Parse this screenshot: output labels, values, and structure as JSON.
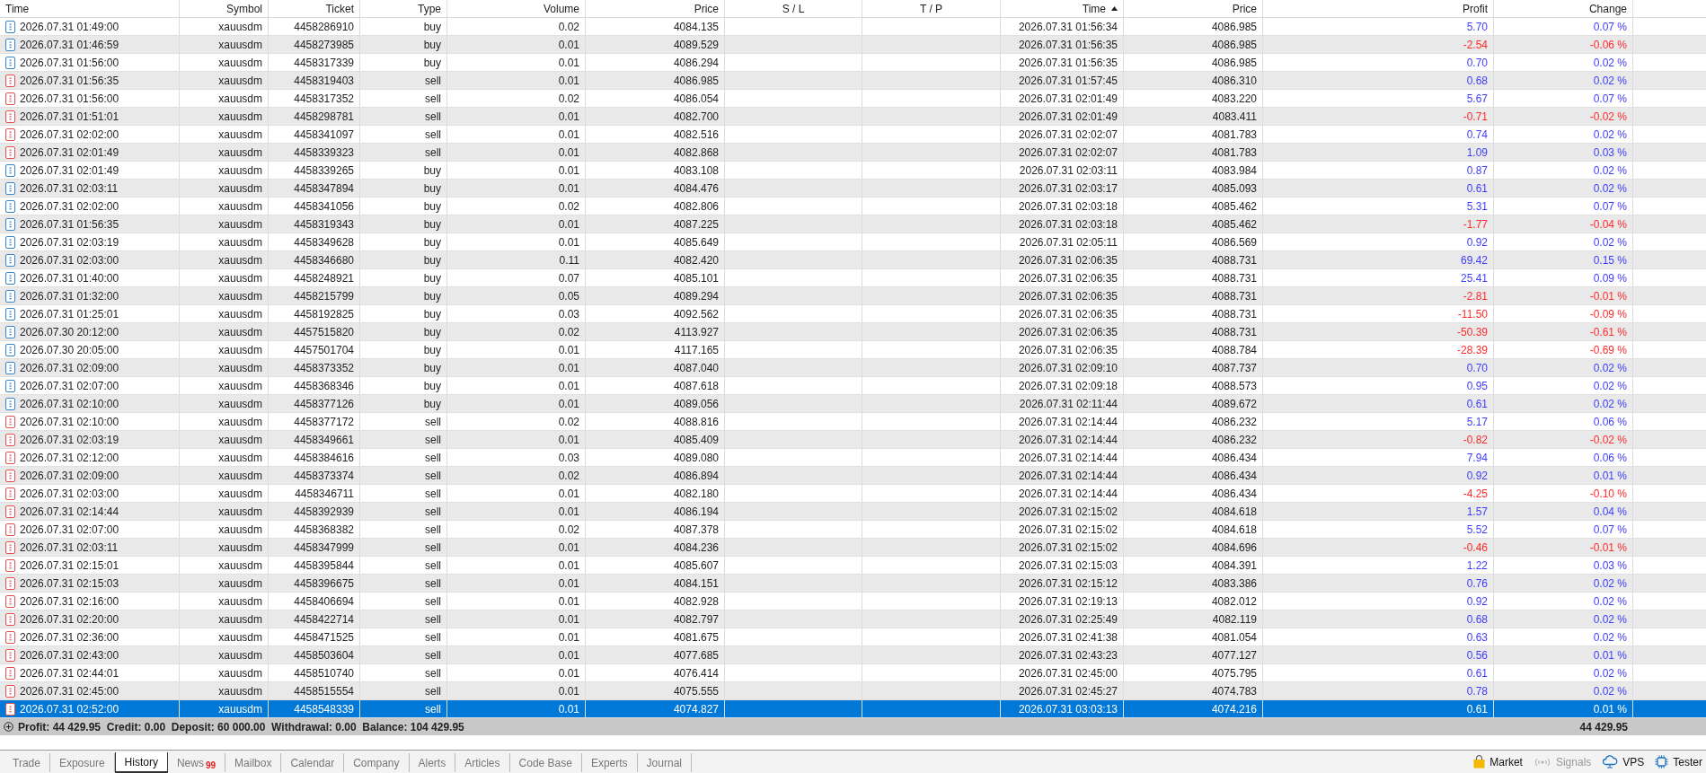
{
  "table": {
    "columns": [
      {
        "label": "Time",
        "sorted": false
      },
      {
        "label": "Symbol",
        "sorted": false
      },
      {
        "label": "Ticket",
        "sorted": false
      },
      {
        "label": "Type",
        "sorted": false
      },
      {
        "label": "Volume",
        "sorted": false
      },
      {
        "label": "Price",
        "sorted": false
      },
      {
        "label": "S / L",
        "sorted": false
      },
      {
        "label": "T / P",
        "sorted": false
      },
      {
        "label": "Time",
        "sorted": true
      },
      {
        "label": "Price",
        "sorted": false
      },
      {
        "label": "Profit",
        "sorted": false
      },
      {
        "label": "Change",
        "sorted": false
      }
    ],
    "rows": [
      {
        "open_time": "2026.07.31 01:49:00",
        "symbol": "xauusdm",
        "ticket": "4458286910",
        "type": "buy",
        "kind": "buy",
        "volume": "0.02",
        "open_price": "4084.135",
        "close_time": "2026.07.31 01:56:34",
        "close_price": "4086.985",
        "profit": "5.70",
        "change": "0.07 %",
        "loss": false,
        "selected": false
      },
      {
        "open_time": "2026.07.31 01:46:59",
        "symbol": "xauusdm",
        "ticket": "4458273985",
        "type": "buy",
        "kind": "buy",
        "volume": "0.01",
        "open_price": "4089.529",
        "close_time": "2026.07.31 01:56:35",
        "close_price": "4086.985",
        "profit": "-2.54",
        "change": "-0.06 %",
        "loss": true,
        "selected": false
      },
      {
        "open_time": "2026.07.31 01:56:00",
        "symbol": "xauusdm",
        "ticket": "4458317339",
        "type": "buy",
        "kind": "buy",
        "volume": "0.01",
        "open_price": "4086.294",
        "close_time": "2026.07.31 01:56:35",
        "close_price": "4086.985",
        "profit": "0.70",
        "change": "0.02 %",
        "loss": false,
        "selected": false
      },
      {
        "open_time": "2026.07.31 01:56:35",
        "symbol": "xauusdm",
        "ticket": "4458319403",
        "type": "sell",
        "kind": "sell",
        "volume": "0.01",
        "open_price": "4086.985",
        "close_time": "2026.07.31 01:57:45",
        "close_price": "4086.310",
        "profit": "0.68",
        "change": "0.02 %",
        "loss": false,
        "selected": false
      },
      {
        "open_time": "2026.07.31 01:56:00",
        "symbol": "xauusdm",
        "ticket": "4458317352",
        "type": "sell",
        "kind": "sell",
        "volume": "0.02",
        "open_price": "4086.054",
        "close_time": "2026.07.31 02:01:49",
        "close_price": "4083.220",
        "profit": "5.67",
        "change": "0.07 %",
        "loss": false,
        "selected": false
      },
      {
        "open_time": "2026.07.31 01:51:01",
        "symbol": "xauusdm",
        "ticket": "4458298781",
        "type": "sell",
        "kind": "sell",
        "volume": "0.01",
        "open_price": "4082.700",
        "close_time": "2026.07.31 02:01:49",
        "close_price": "4083.411",
        "profit": "-0.71",
        "change": "-0.02 %",
        "loss": true,
        "selected": false
      },
      {
        "open_time": "2026.07.31 02:02:00",
        "symbol": "xauusdm",
        "ticket": "4458341097",
        "type": "sell",
        "kind": "sell",
        "volume": "0.01",
        "open_price": "4082.516",
        "close_time": "2026.07.31 02:02:07",
        "close_price": "4081.783",
        "profit": "0.74",
        "change": "0.02 %",
        "loss": false,
        "selected": false
      },
      {
        "open_time": "2026.07.31 02:01:49",
        "symbol": "xauusdm",
        "ticket": "4458339323",
        "type": "sell",
        "kind": "sell",
        "volume": "0.01",
        "open_price": "4082.868",
        "close_time": "2026.07.31 02:02:07",
        "close_price": "4081.783",
        "profit": "1.09",
        "change": "0.03 %",
        "loss": false,
        "selected": false
      },
      {
        "open_time": "2026.07.31 02:01:49",
        "symbol": "xauusdm",
        "ticket": "4458339265",
        "type": "buy",
        "kind": "buy",
        "volume": "0.01",
        "open_price": "4083.108",
        "close_time": "2026.07.31 02:03:11",
        "close_price": "4083.984",
        "profit": "0.87",
        "change": "0.02 %",
        "loss": false,
        "selected": false
      },
      {
        "open_time": "2026.07.31 02:03:11",
        "symbol": "xauusdm",
        "ticket": "4458347894",
        "type": "buy",
        "kind": "buy",
        "volume": "0.01",
        "open_price": "4084.476",
        "close_time": "2026.07.31 02:03:17",
        "close_price": "4085.093",
        "profit": "0.61",
        "change": "0.02 %",
        "loss": false,
        "selected": false
      },
      {
        "open_time": "2026.07.31 02:02:00",
        "symbol": "xauusdm",
        "ticket": "4458341056",
        "type": "buy",
        "kind": "buy",
        "volume": "0.02",
        "open_price": "4082.806",
        "close_time": "2026.07.31 02:03:18",
        "close_price": "4085.462",
        "profit": "5.31",
        "change": "0.07 %",
        "loss": false,
        "selected": false
      },
      {
        "open_time": "2026.07.31 01:56:35",
        "symbol": "xauusdm",
        "ticket": "4458319343",
        "type": "buy",
        "kind": "buy",
        "volume": "0.01",
        "open_price": "4087.225",
        "close_time": "2026.07.31 02:03:18",
        "close_price": "4085.462",
        "profit": "-1.77",
        "change": "-0.04 %",
        "loss": true,
        "selected": false
      },
      {
        "open_time": "2026.07.31 02:03:19",
        "symbol": "xauusdm",
        "ticket": "4458349628",
        "type": "buy",
        "kind": "buy",
        "volume": "0.01",
        "open_price": "4085.649",
        "close_time": "2026.07.31 02:05:11",
        "close_price": "4086.569",
        "profit": "0.92",
        "change": "0.02 %",
        "loss": false,
        "selected": false
      },
      {
        "open_time": "2026.07.31 02:03:00",
        "symbol": "xauusdm",
        "ticket": "4458346680",
        "type": "buy",
        "kind": "buy",
        "volume": "0.11",
        "open_price": "4082.420",
        "close_time": "2026.07.31 02:06:35",
        "close_price": "4088.731",
        "profit": "69.42",
        "change": "0.15 %",
        "loss": false,
        "selected": false
      },
      {
        "open_time": "2026.07.31 01:40:00",
        "symbol": "xauusdm",
        "ticket": "4458248921",
        "type": "buy",
        "kind": "buy",
        "volume": "0.07",
        "open_price": "4085.101",
        "close_time": "2026.07.31 02:06:35",
        "close_price": "4088.731",
        "profit": "25.41",
        "change": "0.09 %",
        "loss": false,
        "selected": false
      },
      {
        "open_time": "2026.07.31 01:32:00",
        "symbol": "xauusdm",
        "ticket": "4458215799",
        "type": "buy",
        "kind": "buy",
        "volume": "0.05",
        "open_price": "4089.294",
        "close_time": "2026.07.31 02:06:35",
        "close_price": "4088.731",
        "profit": "-2.81",
        "change": "-0.01 %",
        "loss": true,
        "selected": false
      },
      {
        "open_time": "2026.07.31 01:25:01",
        "symbol": "xauusdm",
        "ticket": "4458192825",
        "type": "buy",
        "kind": "buy",
        "volume": "0.03",
        "open_price": "4092.562",
        "close_time": "2026.07.31 02:06:35",
        "close_price": "4088.731",
        "profit": "-11.50",
        "change": "-0.09 %",
        "loss": true,
        "selected": false
      },
      {
        "open_time": "2026.07.30 20:12:00",
        "symbol": "xauusdm",
        "ticket": "4457515820",
        "type": "buy",
        "kind": "buy",
        "volume": "0.02",
        "open_price": "4113.927",
        "close_time": "2026.07.31 02:06:35",
        "close_price": "4088.731",
        "profit": "-50.39",
        "change": "-0.61 %",
        "loss": true,
        "selected": false
      },
      {
        "open_time": "2026.07.30 20:05:00",
        "symbol": "xauusdm",
        "ticket": "4457501704",
        "type": "buy",
        "kind": "buy",
        "volume": "0.01",
        "open_price": "4117.165",
        "close_time": "2026.07.31 02:06:35",
        "close_price": "4088.784",
        "profit": "-28.39",
        "change": "-0.69 %",
        "loss": true,
        "selected": false
      },
      {
        "open_time": "2026.07.31 02:09:00",
        "symbol": "xauusdm",
        "ticket": "4458373352",
        "type": "buy",
        "kind": "buy",
        "volume": "0.01",
        "open_price": "4087.040",
        "close_time": "2026.07.31 02:09:10",
        "close_price": "4087.737",
        "profit": "0.70",
        "change": "0.02 %",
        "loss": false,
        "selected": false
      },
      {
        "open_time": "2026.07.31 02:07:00",
        "symbol": "xauusdm",
        "ticket": "4458368346",
        "type": "buy",
        "kind": "buy",
        "volume": "0.01",
        "open_price": "4087.618",
        "close_time": "2026.07.31 02:09:18",
        "close_price": "4088.573",
        "profit": "0.95",
        "change": "0.02 %",
        "loss": false,
        "selected": false
      },
      {
        "open_time": "2026.07.31 02:10:00",
        "symbol": "xauusdm",
        "ticket": "4458377126",
        "type": "buy",
        "kind": "buy",
        "volume": "0.01",
        "open_price": "4089.056",
        "close_time": "2026.07.31 02:11:44",
        "close_price": "4089.672",
        "profit": "0.61",
        "change": "0.02 %",
        "loss": false,
        "selected": false
      },
      {
        "open_time": "2026.07.31 02:10:00",
        "symbol": "xauusdm",
        "ticket": "4458377172",
        "type": "sell",
        "kind": "sell",
        "volume": "0.02",
        "open_price": "4088.816",
        "close_time": "2026.07.31 02:14:44",
        "close_price": "4086.232",
        "profit": "5.17",
        "change": "0.06 %",
        "loss": false,
        "selected": false
      },
      {
        "open_time": "2026.07.31 02:03:19",
        "symbol": "xauusdm",
        "ticket": "4458349661",
        "type": "sell",
        "kind": "sell",
        "volume": "0.01",
        "open_price": "4085.409",
        "close_time": "2026.07.31 02:14:44",
        "close_price": "4086.232",
        "profit": "-0.82",
        "change": "-0.02 %",
        "loss": true,
        "selected": false
      },
      {
        "open_time": "2026.07.31 02:12:00",
        "symbol": "xauusdm",
        "ticket": "4458384616",
        "type": "sell",
        "kind": "sell",
        "volume": "0.03",
        "open_price": "4089.080",
        "close_time": "2026.07.31 02:14:44",
        "close_price": "4086.434",
        "profit": "7.94",
        "change": "0.06 %",
        "loss": false,
        "selected": false
      },
      {
        "open_time": "2026.07.31 02:09:00",
        "symbol": "xauusdm",
        "ticket": "4458373374",
        "type": "sell",
        "kind": "sell",
        "volume": "0.02",
        "open_price": "4086.894",
        "close_time": "2026.07.31 02:14:44",
        "close_price": "4086.434",
        "profit": "0.92",
        "change": "0.01 %",
        "loss": false,
        "selected": false
      },
      {
        "open_time": "2026.07.31 02:03:00",
        "symbol": "xauusdm",
        "ticket": "4458346711",
        "type": "sell",
        "kind": "sell",
        "volume": "0.01",
        "open_price": "4082.180",
        "close_time": "2026.07.31 02:14:44",
        "close_price": "4086.434",
        "profit": "-4.25",
        "change": "-0.10 %",
        "loss": true,
        "selected": false
      },
      {
        "open_time": "2026.07.31 02:14:44",
        "symbol": "xauusdm",
        "ticket": "4458392939",
        "type": "sell",
        "kind": "sell",
        "volume": "0.01",
        "open_price": "4086.194",
        "close_time": "2026.07.31 02:15:02",
        "close_price": "4084.618",
        "profit": "1.57",
        "change": "0.04 %",
        "loss": false,
        "selected": false
      },
      {
        "open_time": "2026.07.31 02:07:00",
        "symbol": "xauusdm",
        "ticket": "4458368382",
        "type": "sell",
        "kind": "sell",
        "volume": "0.02",
        "open_price": "4087.378",
        "close_time": "2026.07.31 02:15:02",
        "close_price": "4084.618",
        "profit": "5.52",
        "change": "0.07 %",
        "loss": false,
        "selected": false
      },
      {
        "open_time": "2026.07.31 02:03:11",
        "symbol": "xauusdm",
        "ticket": "4458347999",
        "type": "sell",
        "kind": "sell",
        "volume": "0.01",
        "open_price": "4084.236",
        "close_time": "2026.07.31 02:15:02",
        "close_price": "4084.696",
        "profit": "-0.46",
        "change": "-0.01 %",
        "loss": true,
        "selected": false
      },
      {
        "open_time": "2026.07.31 02:15:01",
        "symbol": "xauusdm",
        "ticket": "4458395844",
        "type": "sell",
        "kind": "sell",
        "volume": "0.01",
        "open_price": "4085.607",
        "close_time": "2026.07.31 02:15:03",
        "close_price": "4084.391",
        "profit": "1.22",
        "change": "0.03 %",
        "loss": false,
        "selected": false
      },
      {
        "open_time": "2026.07.31 02:15:03",
        "symbol": "xauusdm",
        "ticket": "4458396675",
        "type": "sell",
        "kind": "sell",
        "volume": "0.01",
        "open_price": "4084.151",
        "close_time": "2026.07.31 02:15:12",
        "close_price": "4083.386",
        "profit": "0.76",
        "change": "0.02 %",
        "loss": false,
        "selected": false
      },
      {
        "open_time": "2026.07.31 02:16:00",
        "symbol": "xauusdm",
        "ticket": "4458406694",
        "type": "sell",
        "kind": "sell",
        "volume": "0.01",
        "open_price": "4082.928",
        "close_time": "2026.07.31 02:19:13",
        "close_price": "4082.012",
        "profit": "0.92",
        "change": "0.02 %",
        "loss": false,
        "selected": false
      },
      {
        "open_time": "2026.07.31 02:20:00",
        "symbol": "xauusdm",
        "ticket": "4458422714",
        "type": "sell",
        "kind": "sell",
        "volume": "0.01",
        "open_price": "4082.797",
        "close_time": "2026.07.31 02:25:49",
        "close_price": "4082.119",
        "profit": "0.68",
        "change": "0.02 %",
        "loss": false,
        "selected": false
      },
      {
        "open_time": "2026.07.31 02:36:00",
        "symbol": "xauusdm",
        "ticket": "4458471525",
        "type": "sell",
        "kind": "sell",
        "volume": "0.01",
        "open_price": "4081.675",
        "close_time": "2026.07.31 02:41:38",
        "close_price": "4081.054",
        "profit": "0.63",
        "change": "0.02 %",
        "loss": false,
        "selected": false
      },
      {
        "open_time": "2026.07.31 02:43:00",
        "symbol": "xauusdm",
        "ticket": "4458503604",
        "type": "sell",
        "kind": "sell",
        "volume": "0.01",
        "open_price": "4077.685",
        "close_time": "2026.07.31 02:43:23",
        "close_price": "4077.127",
        "profit": "0.56",
        "change": "0.01 %",
        "loss": false,
        "selected": false
      },
      {
        "open_time": "2026.07.31 02:44:01",
        "symbol": "xauusdm",
        "ticket": "4458510740",
        "type": "sell",
        "kind": "sell",
        "volume": "0.01",
        "open_price": "4076.414",
        "close_time": "2026.07.31 02:45:00",
        "close_price": "4075.795",
        "profit": "0.61",
        "change": "0.02 %",
        "loss": false,
        "selected": false
      },
      {
        "open_time": "2026.07.31 02:45:00",
        "symbol": "xauusdm",
        "ticket": "4458515554",
        "type": "sell",
        "kind": "sell",
        "volume": "0.01",
        "open_price": "4075.555",
        "close_time": "2026.07.31 02:45:27",
        "close_price": "4074.783",
        "profit": "0.78",
        "change": "0.02 %",
        "loss": false,
        "selected": false
      },
      {
        "open_time": "2026.07.31 02:52:00",
        "symbol": "xauusdm",
        "ticket": "4458548339",
        "type": "sell",
        "kind": "sell",
        "volume": "0.01",
        "open_price": "4074.827",
        "close_time": "2026.07.31 03:03:13",
        "close_price": "4074.216",
        "profit": "0.61",
        "change": "0.01 %",
        "loss": false,
        "selected": true
      }
    ]
  },
  "summary": {
    "text": "Profit: 44 429.95  Credit: 0.00  Deposit: 60 000.00  Withdrawal: 0.00  Balance: 104 429.95",
    "total_profit": "44 429.95"
  },
  "tabs": [
    {
      "label": "Trade",
      "selected": false
    },
    {
      "label": "Exposure",
      "selected": false
    },
    {
      "label": "History",
      "selected": true
    },
    {
      "label": "News",
      "badge": "99",
      "selected": false
    },
    {
      "label": "Mailbox",
      "selected": false
    },
    {
      "label": "Calendar",
      "selected": false
    },
    {
      "label": "Company",
      "selected": false
    },
    {
      "label": "Alerts",
      "selected": false
    },
    {
      "label": "Articles",
      "selected": false
    },
    {
      "label": "Code Base",
      "selected": false
    },
    {
      "label": "Experts",
      "selected": false
    },
    {
      "label": "Journal",
      "selected": false
    }
  ],
  "services": [
    {
      "kind": "market",
      "label": "Market",
      "disabled": false
    },
    {
      "kind": "signals",
      "label": "Signals",
      "disabled": true
    },
    {
      "kind": "vps",
      "label": "VPS",
      "disabled": false
    },
    {
      "kind": "tester",
      "label": "Tester",
      "disabled": false
    }
  ]
}
